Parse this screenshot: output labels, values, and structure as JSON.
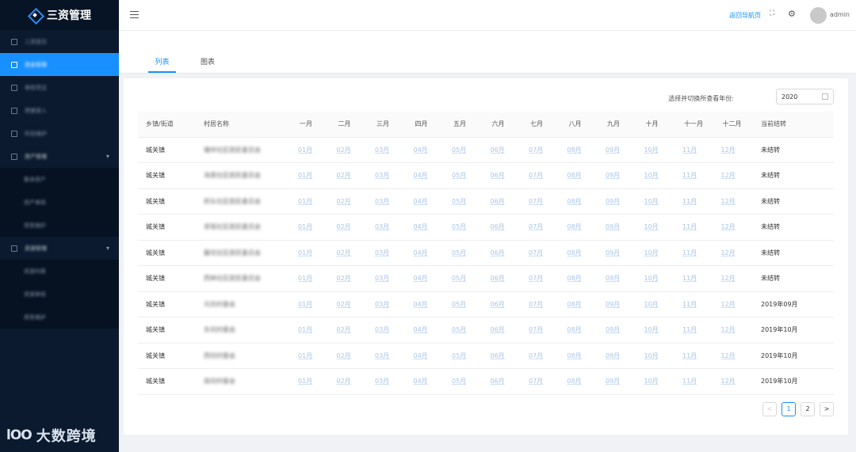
{
  "app": {
    "title": "三资管理"
  },
  "sidebar": {
    "items": [
      {
        "label": "三资首页",
        "type": "item"
      },
      {
        "label": "资金管理",
        "type": "item",
        "active": true
      },
      {
        "label": "审核凭证",
        "type": "item"
      },
      {
        "label": "票据录入",
        "type": "item"
      },
      {
        "label": "科目维护",
        "type": "item"
      },
      {
        "label": "资产管理",
        "type": "group"
      },
      {
        "label": "集体资产",
        "type": "sub"
      },
      {
        "label": "资产审核",
        "type": "sub"
      },
      {
        "label": "类型维护",
        "type": "sub"
      },
      {
        "label": "资源管理",
        "type": "group"
      },
      {
        "label": "资源列表",
        "type": "sub"
      },
      {
        "label": "资源审核",
        "type": "sub"
      },
      {
        "label": "类型维护",
        "type": "sub"
      }
    ],
    "watermark": "大数跨境",
    "watermark_logo": "lOO"
  },
  "header": {
    "back_link": "返回导航页",
    "avatar_text": "admin",
    "username": "admin"
  },
  "tabs": [
    {
      "label": "列表",
      "active": true
    },
    {
      "label": "图表",
      "active": false
    }
  ],
  "filter": {
    "label": "选择并切换所查看年份:",
    "year": "2020"
  },
  "table": {
    "headers": [
      "乡镇/街道",
      "村居名称",
      "一月",
      "二月",
      "三月",
      "四月",
      "五月",
      "六月",
      "七月",
      "八月",
      "九月",
      "十月",
      "十一月",
      "十二月",
      "当前结转"
    ],
    "month_links": [
      "01月",
      "02月",
      "03月",
      "04月",
      "05月",
      "06月",
      "07月",
      "08月",
      "09月",
      "10月",
      "11月",
      "12月"
    ],
    "rows": [
      {
        "town": "城关镇",
        "village": "塘岸社区居民委员会",
        "status": "未结转"
      },
      {
        "town": "城关镇",
        "village": "海垦社区居民委员会",
        "status": "未结转"
      },
      {
        "town": "城关镇",
        "village": "桥头社区居民委员会",
        "status": "未结转"
      },
      {
        "town": "城关镇",
        "village": "求雨社区居民委员会",
        "status": "未结转"
      },
      {
        "town": "城关镇",
        "village": "藤坑社区居民委员会",
        "status": "未结转"
      },
      {
        "town": "城关镇",
        "village": "西林社区居民委员会",
        "status": "未结转"
      },
      {
        "town": "城关镇",
        "village": "元坑村委会",
        "status": "2019年09月"
      },
      {
        "town": "城关镇",
        "village": "东坑村委会",
        "status": "2019年10月"
      },
      {
        "town": "城关镇",
        "village": "西坑村委会",
        "status": "2019年10月"
      },
      {
        "town": "城关镇",
        "village": "南坑村委会",
        "status": "2019年10月"
      }
    ]
  },
  "pagination": {
    "prev": "<",
    "pages": [
      "1",
      "2"
    ],
    "next": ">",
    "current": "1"
  }
}
